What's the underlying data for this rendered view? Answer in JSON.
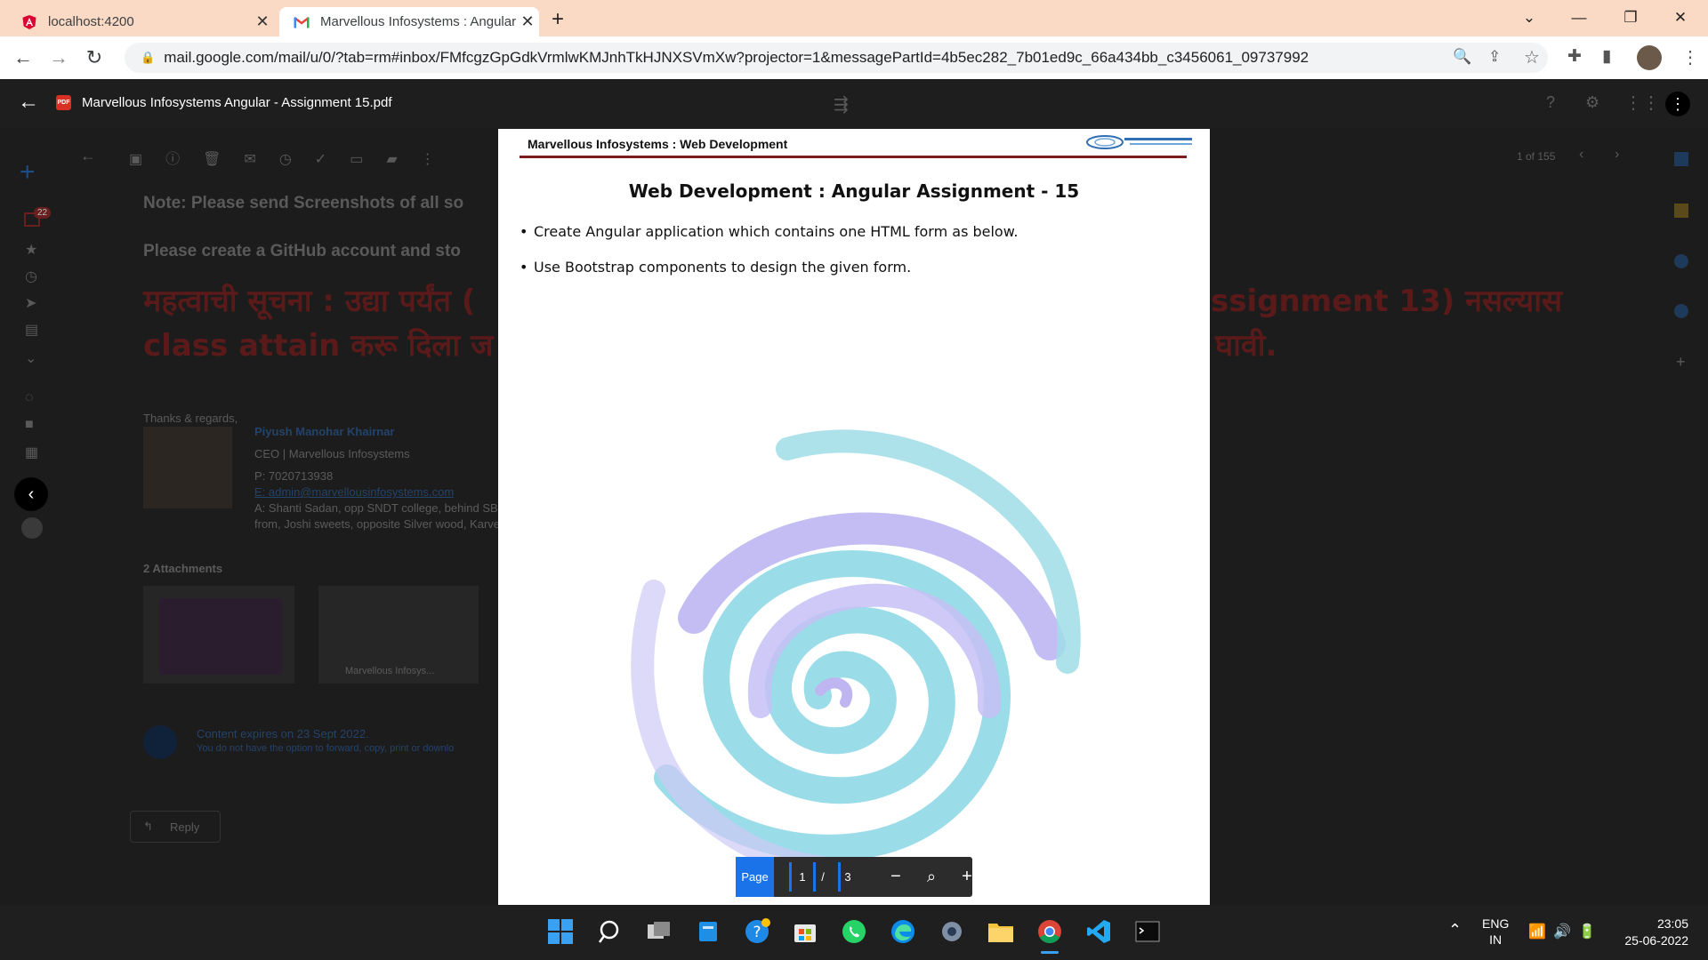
{
  "browser": {
    "tabs": [
      {
        "title": "localhost:4200",
        "active": false
      },
      {
        "title": "Marvellous Infosystems : Angular",
        "active": true
      }
    ],
    "url": "mail.google.com/mail/u/0/?tab=rm#inbox/FMfcgzGpGdkVrmlwKMJnhTkHJNXSVmXw?projector=1&messagePartId=4b5ec282_7b01ed9c_66a434bb_c3456061_09737992"
  },
  "viewer": {
    "file_name": "Marvellous Infosystems Angular - Assignment 15.pdf",
    "pdf_badge": "PDF"
  },
  "pdf": {
    "header": "Marvellous Infosystems : Web Development",
    "title": "Web Development : Angular Assignment - 15",
    "bullets": [
      "Create Angular application which contains one HTML form as below.",
      "Use Bootstrap components to design the given form."
    ]
  },
  "page_controls": {
    "page_label": "Page",
    "current_page": "1",
    "separator": "/",
    "total_pages": "3"
  },
  "gmail_background": {
    "note_line": "Note: Please send Screenshots of all so",
    "github_line": "Please create a GitHub account and sto",
    "marathi_line1_left": "महत्वाची सूचना : उद्या पर्यंत (",
    "marathi_line1_right": "ssignment 13) नसल्यास",
    "marathi_line2_left": "class attain करू दिला ज",
    "marathi_line2_right": "घावी.",
    "regards": "Thanks & regards,",
    "sender_name": "Piyush Manohar Khairnar",
    "sender_role": "CEO | Marvellous Infosystems",
    "phone": "P:  7020713938",
    "email": "E:  admin@marvellousinfosystems.com",
    "address1": "A: Shanti Sadan, opp SNDT college, behind SB",
    "address2": "from, Joshi sweets, opposite Silver wood, Karve",
    "attachments_label": "2 Attachments",
    "attachment_name": "Marvellous Infosys...",
    "expires": "Content expires on 23 Sept 2022.",
    "expires_sub": "You do not have the option to forward, copy, print or downlo",
    "reply": "Reply",
    "counter": "1 of 155",
    "badge_count": "22"
  },
  "taskbar": {
    "lang_top": "ENG",
    "lang_bottom": "IN",
    "time": "23:05",
    "date": "25-06-2022"
  },
  "colors": {
    "tab_strip": "#fad9c5",
    "pdf_rule": "#7a1d1d",
    "accent_blue": "#1a73e8"
  }
}
